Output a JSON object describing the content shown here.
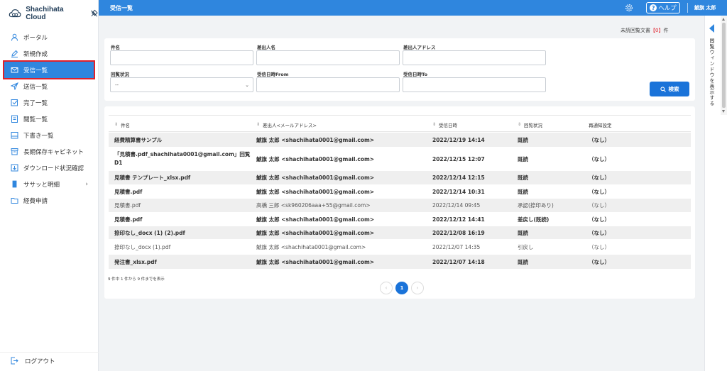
{
  "brand": {
    "name": "Shachihata Cloud"
  },
  "sidebar": {
    "items": [
      {
        "label": "ポータル",
        "icon": "user-icon"
      },
      {
        "label": "新規作成",
        "icon": "pencil-icon"
      },
      {
        "label": "受信一覧",
        "icon": "mail-icon",
        "active": true
      },
      {
        "label": "送信一覧",
        "icon": "send-icon"
      },
      {
        "label": "完了一覧",
        "icon": "check-square-icon"
      },
      {
        "label": "閲覧一覧",
        "icon": "document-icon"
      },
      {
        "label": "下書き一覧",
        "icon": "drive-icon"
      },
      {
        "label": "長期保存キャビネット",
        "icon": "archive-icon"
      },
      {
        "label": "ダウンロード状況確認",
        "icon": "download-icon"
      },
      {
        "label": "ササッと明細",
        "icon": "wallet-icon",
        "has_children": true
      },
      {
        "label": "経費申請",
        "icon": "folder-icon"
      }
    ],
    "logout": "ログアウト"
  },
  "header": {
    "title": "受信一覧",
    "help": "ヘルプ",
    "user": "鯱旗 太郎"
  },
  "unread": {
    "prefix": "未読回覧文書",
    "count": "0",
    "suffix": "件"
  },
  "vpane": {
    "label": "閲覧ウィンドウを表示する"
  },
  "search": {
    "subject_label": "件名",
    "sender_label": "差出人名",
    "sender_address_label": "差出人アドレス",
    "status_label": "回覧状況",
    "status_value": "--",
    "from_label": "受信日時From",
    "to_label": "受信日時To",
    "button": "検索"
  },
  "table": {
    "headers": [
      "件名",
      "差出人<メールアドレス>",
      "受信日時",
      "回覧状況",
      "再通知設定"
    ],
    "rows": [
      {
        "subject": "経費精算書サンプル",
        "sender": "鯱旗 太郎 <shachihata0001@gmail.com>",
        "date": "2022/12/19 14:14",
        "status": "既読",
        "notice": "（なし）",
        "bold": true
      },
      {
        "subject": "「見積書.pdf_shachihata0001@gmail.com」回覧",
        "subject2": "D1",
        "sender": "鯱旗 太郎 <shachihata0001@gmail.com>",
        "date": "2022/12/15 12:07",
        "status": "既読",
        "notice": "（なし）",
        "bold": true
      },
      {
        "subject": "見積書 テンプレート_xlsx.pdf",
        "sender": "鯱旗 太郎 <shachihata0001@gmail.com>",
        "date": "2022/12/14 12:15",
        "status": "既読",
        "notice": "（なし）",
        "bold": true
      },
      {
        "subject": "見積書.pdf",
        "sender": "鯱旗 太郎 <shachihata0001@gmail.com>",
        "date": "2022/12/14 10:31",
        "status": "既読",
        "notice": "（なし）",
        "bold": true
      },
      {
        "subject": "見積書.pdf",
        "sender": "高橋 三郎 <sk960206aaa+55@gmail.com>",
        "date": "2022/12/14 09:45",
        "status": "承認(捺印あり)",
        "notice": "（なし）",
        "bold": false
      },
      {
        "subject": "見積書.pdf",
        "sender": "鯱旗 太郎 <shachihata0001@gmail.com>",
        "date": "2022/12/12 14:41",
        "status": "差戻し(既読)",
        "notice": "（なし）",
        "bold": true
      },
      {
        "subject": "捺印なし_docx (1) (2).pdf",
        "sender": "鯱旗 太郎 <shachihata0001@gmail.com>",
        "date": "2022/12/08 16:19",
        "status": "既読",
        "notice": "（なし）",
        "bold": true
      },
      {
        "subject": "捺印なし_docx (1).pdf",
        "sender": "鯱旗 太郎 <shachihata0001@gmail.com>",
        "date": "2022/12/07 14:35",
        "status": "引戻し",
        "notice": "（なし）",
        "bold": false
      },
      {
        "subject": "発注書_xlsx.pdf",
        "sender": "鯱旗 太郎 <shachihata0001@gmail.com>",
        "date": "2022/12/07 14:18",
        "status": "既読",
        "notice": "（なし）",
        "bold": true
      }
    ],
    "count_text": "9 件中 1 件から 9 件までを表示"
  },
  "pager": {
    "prev": "‹",
    "current": "1",
    "next": "›"
  }
}
